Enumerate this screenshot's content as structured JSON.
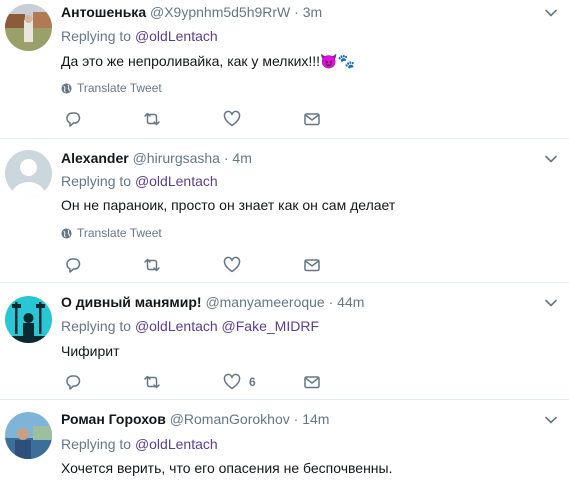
{
  "tweets": [
    {
      "name": "Антошенька",
      "handle": "@X9ypnhm5d5h9RrW",
      "dot": "·",
      "time": "3m",
      "replying_label": "Replying to",
      "mentions": [
        "@oldLentach"
      ],
      "text": "Да это же непроливайка, как у мелких!!!😈🐾",
      "translate": "Translate Tweet",
      "likes": ""
    },
    {
      "name": "Alexander",
      "handle": "@hirurgsasha",
      "dot": "·",
      "time": "4m",
      "replying_label": "Replying to",
      "mentions": [
        "@oldLentach"
      ],
      "text": "Он не параноик,  просто он знает как он сам делает",
      "translate": "Translate Tweet",
      "likes": ""
    },
    {
      "name": "О дивный манямир!",
      "handle": "@manyameeroque",
      "dot": "·",
      "time": "44m",
      "replying_label": "Replying to",
      "mentions": [
        "@oldLentach",
        "@Fake_MIDRF"
      ],
      "text": "Чифирит",
      "translate": "",
      "likes": "6"
    },
    {
      "name": "Роман Горохов",
      "handle": "@RomanGorokhov",
      "dot": "·",
      "time": "14m",
      "replying_label": "Replying to",
      "mentions": [
        "@oldLentach"
      ],
      "text": "Хочется верить, что его опасения не беспочвенны.",
      "translate": "",
      "likes": ""
    }
  ],
  "colors": {
    "name": "#14171a",
    "secondary": "#657786",
    "mention": "#5b3f8c",
    "divider": "#e6ecf0"
  },
  "icons": [
    "reply-icon",
    "retweet-icon",
    "like-icon",
    "message-icon",
    "globe-icon",
    "chevron-down-icon"
  ]
}
